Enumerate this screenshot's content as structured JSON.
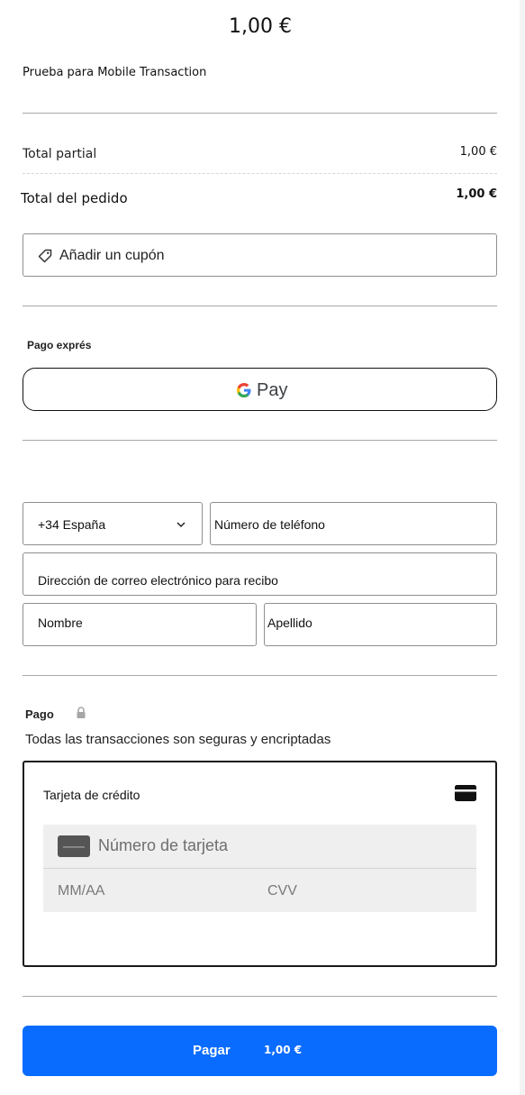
{
  "header": {
    "total": "1,00 €",
    "description": "Prueba para Mobile Transaction"
  },
  "summary": {
    "subtotal_label": "Total partial",
    "subtotal_value": "1,00 €",
    "total_label": "Total del pedido",
    "total_value": "1,00 €"
  },
  "coupon": {
    "icon": "tag-icon",
    "label": "Añadir un cupón"
  },
  "express": {
    "title": "Pago exprés",
    "gpay_label": "Pay"
  },
  "contact": {
    "country_value": "+34 España",
    "phone_placeholder": "Número de teléfono",
    "email_placeholder": "Dirección de correo electrónico para recibo",
    "first_name_placeholder": "Nombre",
    "last_name_placeholder": "Apellido"
  },
  "payment": {
    "title": "Pago",
    "secure_text": "Todas las transacciones son seguras y encriptadas",
    "method_label": "Tarjeta de crédito",
    "card_number_placeholder": "Número de tarjeta",
    "expiry_placeholder": "MM/AA",
    "cvv_placeholder": "CVV"
  },
  "pay_button": {
    "label": "Pagar",
    "amount": "1,00 €",
    "color": "#0a6cff"
  }
}
